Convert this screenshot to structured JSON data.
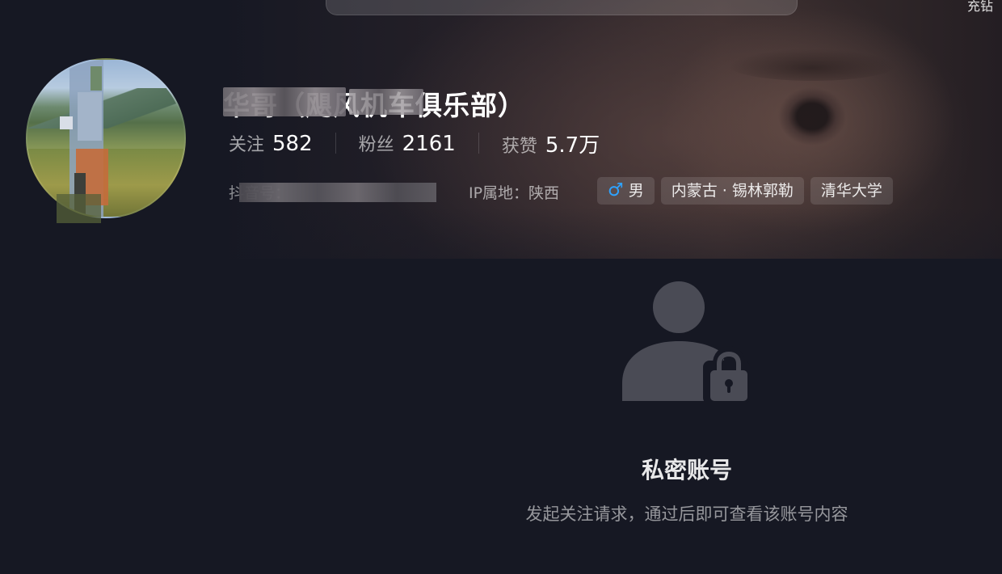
{
  "header": {
    "search_placeholder": "",
    "recharge_label": "充钻"
  },
  "profile": {
    "nickname": "华哥（飓风机车俱乐部）",
    "stats": [
      {
        "label": "关注",
        "value": "582"
      },
      {
        "label": "粉丝",
        "value": "2161"
      },
      {
        "label": "获赞",
        "value": "5.7万"
      }
    ],
    "douyin_id": "抖音号：",
    "ip_location": "IP属地：陕西",
    "tags": [
      {
        "icon": "male-icon",
        "icon_glyph": "♂",
        "label": "男"
      },
      {
        "label": "内蒙古 · 锡林郭勒"
      },
      {
        "label": "清华大学"
      }
    ]
  },
  "private": {
    "title": "私密账号",
    "description": "发起关注请求，通过后即可查看该账号内容"
  },
  "colors": {
    "background": "#161823",
    "gender_male": "#2ea3ff",
    "lock_icon": "#4a4b55"
  }
}
